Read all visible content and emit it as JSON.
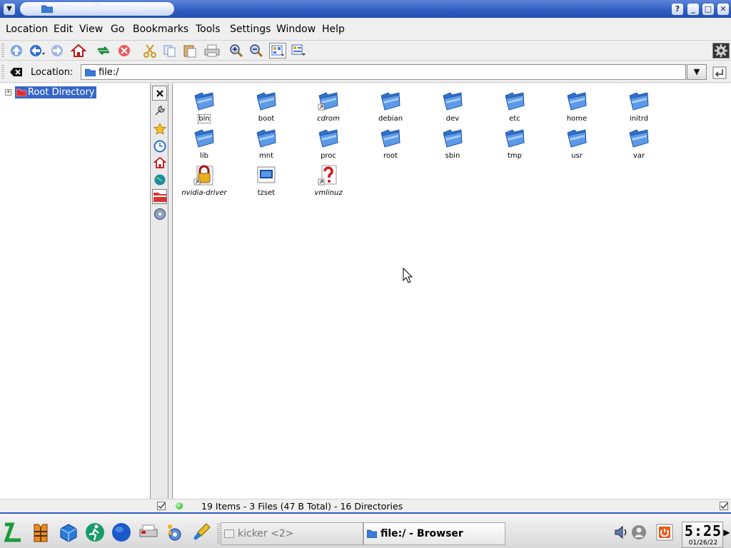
{
  "window": {
    "title": "file:/ - Browser",
    "buttons": {
      "help": "?",
      "minimize": "_",
      "maximize": "□",
      "close": "✕"
    }
  },
  "menubar": {
    "items": [
      "Location",
      "Edit",
      "View",
      "Go",
      "Bookmarks",
      "Tools",
      "Settings",
      "Window",
      "Help"
    ]
  },
  "toolbar": {
    "icons": [
      "up-icon",
      "back-icon",
      "forward-icon",
      "home-icon",
      "reload-icon",
      "stop-icon",
      "cut-icon",
      "copy-icon",
      "paste-icon",
      "print-icon",
      "zoom-in-icon",
      "zoom-out-icon",
      "icon-view-icon",
      "detail-view-icon",
      "throbber-gear-icon"
    ]
  },
  "location": {
    "label": "Location:",
    "value": "file:/"
  },
  "tree": {
    "root_label": "Root Directory"
  },
  "sidebar": {
    "buttons": [
      "close-icon",
      "services-icon",
      "bookmarks-star-icon",
      "history-clock-icon",
      "home-icon",
      "network-globe-icon",
      "root-folder-icon",
      "media-cd-icon"
    ]
  },
  "files": [
    {
      "name": "bin",
      "type": "folder",
      "link": false,
      "focused": true
    },
    {
      "name": "boot",
      "type": "folder",
      "link": false,
      "focused": false
    },
    {
      "name": "cdrom",
      "type": "folder",
      "link": true,
      "focused": false
    },
    {
      "name": "debian",
      "type": "folder",
      "link": false,
      "focused": false
    },
    {
      "name": "dev",
      "type": "folder",
      "link": false,
      "focused": false
    },
    {
      "name": "etc",
      "type": "folder",
      "link": false,
      "focused": false
    },
    {
      "name": "home",
      "type": "folder",
      "link": false,
      "focused": false
    },
    {
      "name": "initrd",
      "type": "folder",
      "link": false,
      "focused": false
    },
    {
      "name": "lib",
      "type": "folder",
      "link": false,
      "focused": false
    },
    {
      "name": "mnt",
      "type": "folder",
      "link": false,
      "focused": false
    },
    {
      "name": "proc",
      "type": "folder",
      "link": false,
      "focused": false
    },
    {
      "name": "root",
      "type": "folder",
      "link": false,
      "focused": false
    },
    {
      "name": "sbin",
      "type": "folder",
      "link": false,
      "focused": false
    },
    {
      "name": "tmp",
      "type": "folder",
      "link": false,
      "focused": false
    },
    {
      "name": "usr",
      "type": "folder",
      "link": false,
      "focused": false
    },
    {
      "name": "var",
      "type": "folder",
      "link": false,
      "focused": false
    },
    {
      "name": "nvidia-driver",
      "type": "locked-file",
      "link": true,
      "focused": false
    },
    {
      "name": "tzset",
      "type": "executable",
      "link": false,
      "focused": false
    },
    {
      "name": "vmlinuz",
      "type": "unknown",
      "link": true,
      "focused": false
    }
  ],
  "status": {
    "text": "19 Items - 3 Files (47 B Total) - 16 Directories"
  },
  "taskbar": {
    "launchers": [
      "kmenu-icon",
      "lifejacket-icon",
      "cube-icon",
      "runner-icon",
      "globe-icon",
      "printer-icon",
      "kde-gear-icon",
      "paint-icon"
    ],
    "tasks": [
      {
        "label": "kicker <2>",
        "active": false
      },
      {
        "label": "file:/ - Browser",
        "active": true
      }
    ],
    "tray": [
      "volume-icon",
      "user-icon",
      "power-icon"
    ],
    "clock": {
      "time": "5:25",
      "date": "01/26/22"
    }
  },
  "colors": {
    "titlebar": "#2e5cc0",
    "selection": "#3566c8",
    "folder_blue": "#3a7bd5"
  }
}
